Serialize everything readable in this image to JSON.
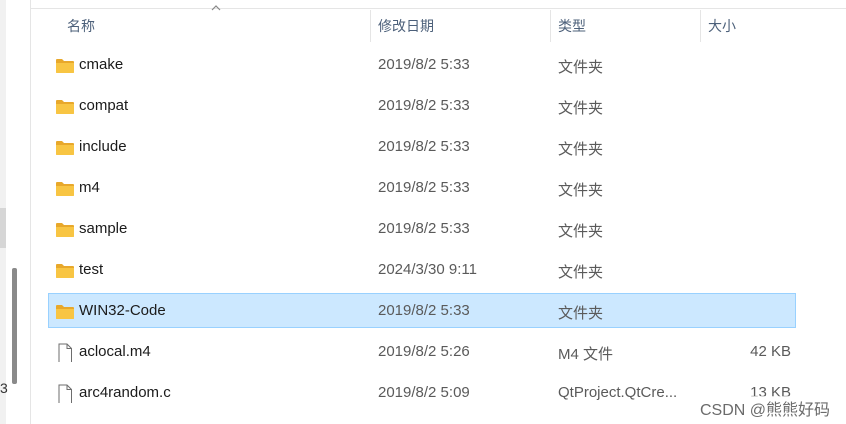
{
  "columns": {
    "name": "名称",
    "modified": "修改日期",
    "type": "类型",
    "size": "大小"
  },
  "rows": [
    {
      "name": "cmake",
      "modified": "2019/8/2 5:33",
      "type": "文件夹",
      "size": "",
      "icon": "folder-icon",
      "selected": false
    },
    {
      "name": "compat",
      "modified": "2019/8/2 5:33",
      "type": "文件夹",
      "size": "",
      "icon": "folder-icon",
      "selected": false
    },
    {
      "name": "include",
      "modified": "2019/8/2 5:33",
      "type": "文件夹",
      "size": "",
      "icon": "folder-icon",
      "selected": false
    },
    {
      "name": "m4",
      "modified": "2019/8/2 5:33",
      "type": "文件夹",
      "size": "",
      "icon": "folder-icon",
      "selected": false
    },
    {
      "name": "sample",
      "modified": "2019/8/2 5:33",
      "type": "文件夹",
      "size": "",
      "icon": "folder-icon",
      "selected": false
    },
    {
      "name": "test",
      "modified": "2024/3/30 9:11",
      "type": "文件夹",
      "size": "",
      "icon": "folder-icon",
      "selected": false
    },
    {
      "name": "WIN32-Code",
      "modified": "2019/8/2 5:33",
      "type": "文件夹",
      "size": "",
      "icon": "folder-icon",
      "selected": true
    },
    {
      "name": "aclocal.m4",
      "modified": "2019/8/2 5:26",
      "type": "M4 文件",
      "size": "42 KB",
      "icon": "file-icon",
      "selected": false
    },
    {
      "name": "arc4random.c",
      "modified": "2019/8/2 5:09",
      "type": "QtProject.QtCre...",
      "size": "13 KB",
      "icon": "file-icon",
      "selected": false
    }
  ],
  "left_strip_text": "3",
  "watermark": "CSDN @熊熊好码",
  "colors": {
    "selection_bg": "#cce8ff",
    "selection_border": "#99d1ff",
    "folder": "#f8c543",
    "header_text": "#4c607a"
  }
}
